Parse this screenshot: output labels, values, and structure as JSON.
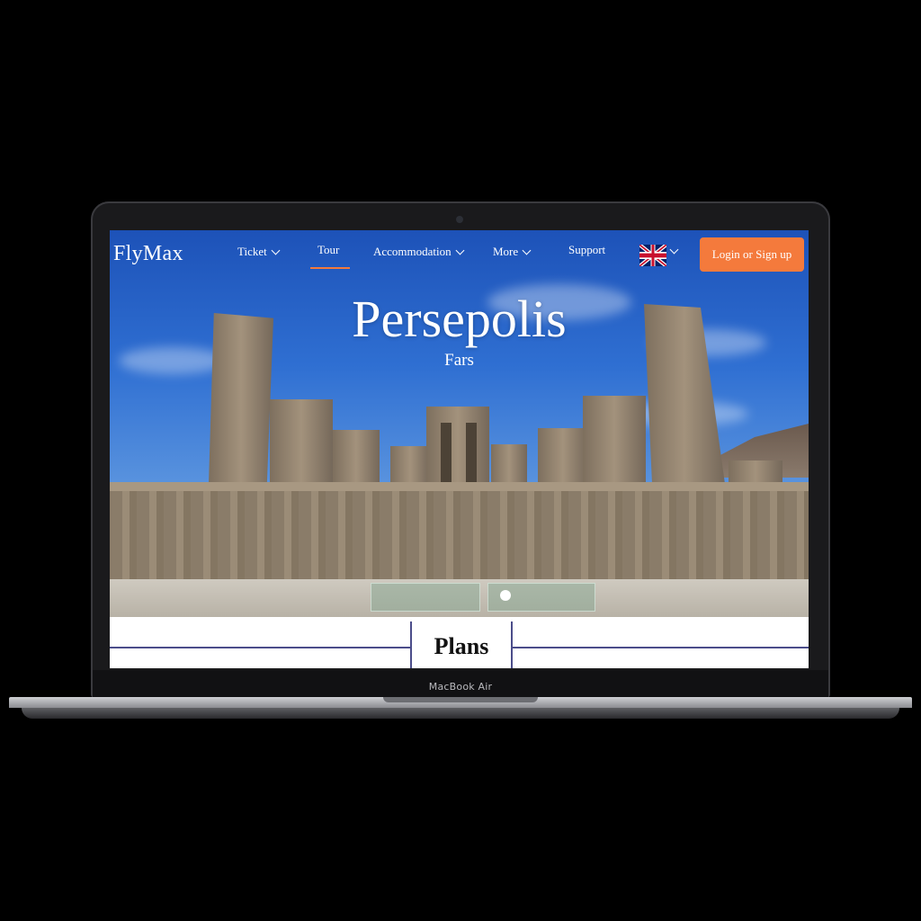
{
  "device": {
    "label": "MacBook Air"
  },
  "nav": {
    "logo": "FlyMax",
    "items": [
      {
        "label": "Ticket",
        "has_dropdown": true,
        "active": false
      },
      {
        "label": "Tour",
        "has_dropdown": false,
        "active": true
      },
      {
        "label": "Accommodation",
        "has_dropdown": true,
        "active": false
      },
      {
        "label": "More",
        "has_dropdown": true,
        "active": false
      },
      {
        "label": "Support",
        "has_dropdown": false,
        "active": false
      }
    ],
    "language_icon": "uk-flag-icon",
    "login_label": "Login or Sign up"
  },
  "hero": {
    "title": "Persepolis",
    "subtitle": "Fars"
  },
  "plans": {
    "title": "Plans"
  },
  "colors": {
    "accent": "#f47a3c",
    "divider": "#4b4d8a",
    "bezel": "#1a1a1c"
  }
}
